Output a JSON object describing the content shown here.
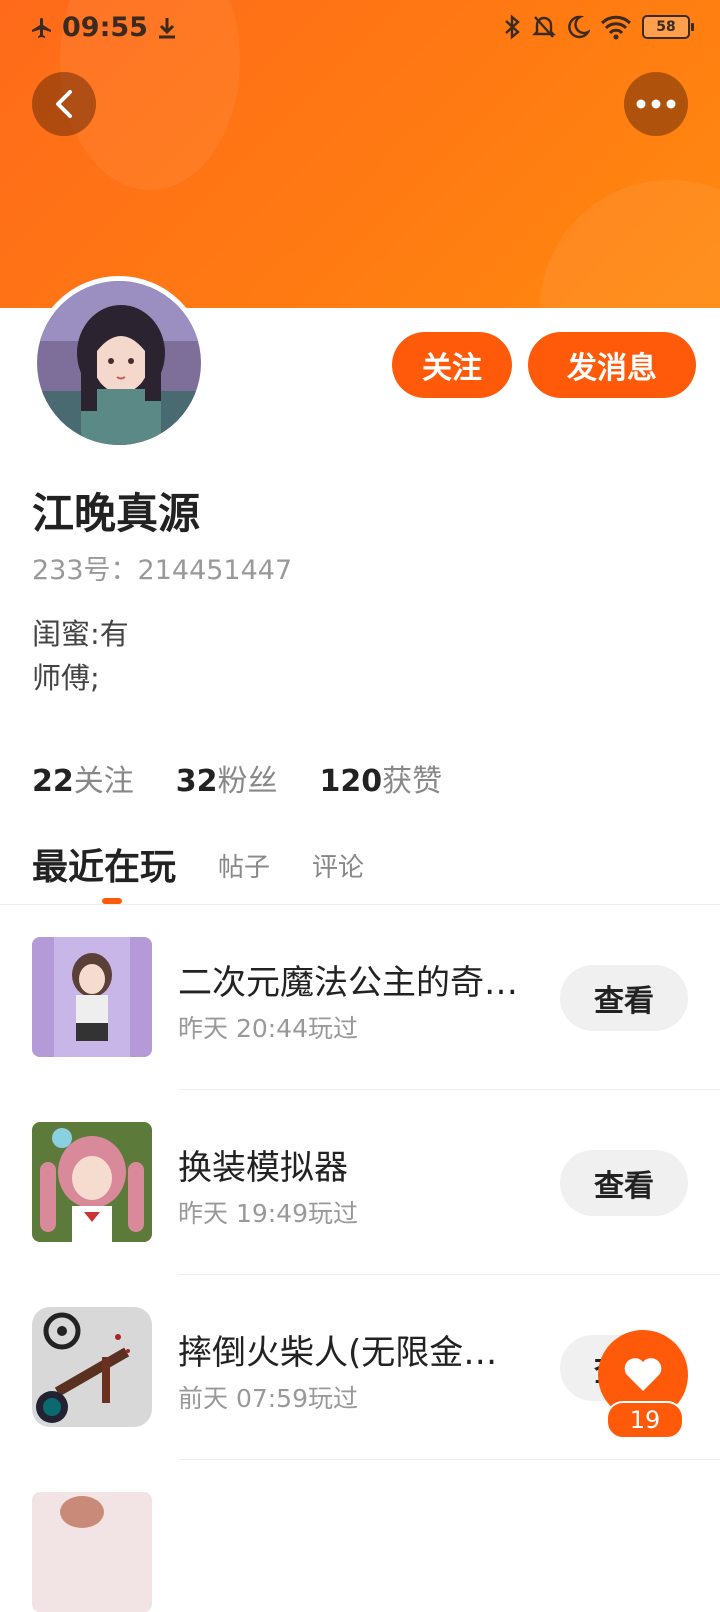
{
  "status_bar": {
    "time": "09:55",
    "battery": "58"
  },
  "profile": {
    "name": "江晚真源",
    "uid_line": "233号：214451447",
    "bio_lines": [
      "闺蜜:有",
      "师傅;"
    ],
    "follow_label": "关注",
    "message_label": "发消息"
  },
  "stats": [
    {
      "num": "22",
      "label": "关注"
    },
    {
      "num": "32",
      "label": "粉丝"
    },
    {
      "num": "120",
      "label": "获赞"
    }
  ],
  "tabs": [
    "最近在玩",
    "帖子",
    "评论"
  ],
  "games": [
    {
      "title": "二次元魔法公主的奇妙冒险",
      "time": "昨天 20:44玩过",
      "button": "查看"
    },
    {
      "title": "换装模拟器",
      "time": "昨天 19:49玩过",
      "button": "查看"
    },
    {
      "title": "摔倒火柴人(无限金币版)",
      "time": "前天 07:59玩过",
      "button": "查看"
    }
  ],
  "fab": {
    "count": "19"
  },
  "colors": {
    "accent": "#ff5a0a",
    "header": "#ff7a12"
  }
}
